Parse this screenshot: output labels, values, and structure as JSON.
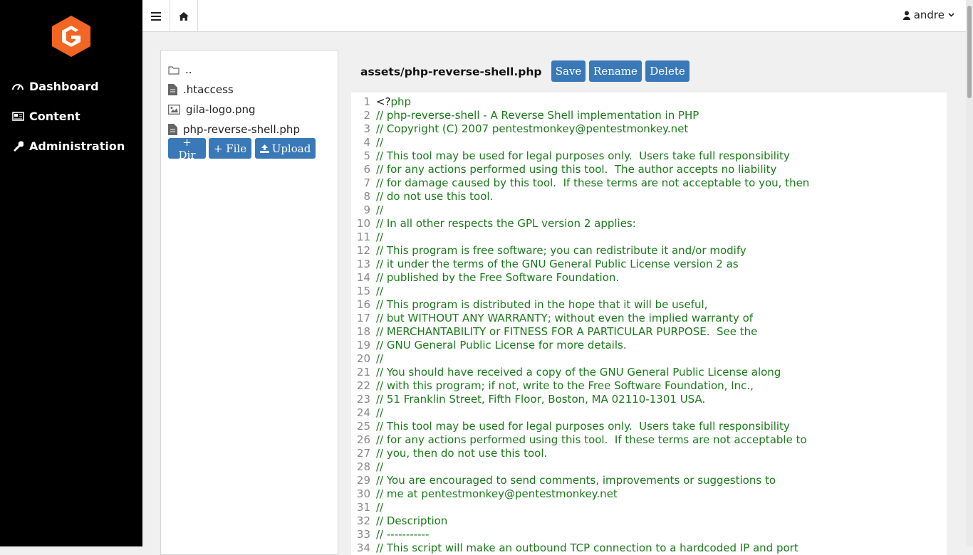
{
  "sidebar": {
    "items": [
      {
        "label": "Dashboard",
        "icon": "dashboard-icon"
      },
      {
        "label": "Content",
        "icon": "newspaper-icon"
      },
      {
        "label": "Administration",
        "icon": "wrench-icon"
      }
    ],
    "brand_color": "#f26522"
  },
  "topbar": {
    "menu_icon": "hamburger-icon",
    "home_icon": "home-icon",
    "user_label": "andre"
  },
  "files": {
    "items": [
      {
        "name": "..",
        "icon": "folder-icon"
      },
      {
        "name": ".htaccess",
        "icon": "file-icon"
      },
      {
        "name": "gila-logo.png",
        "icon": "image-icon"
      },
      {
        "name": "php-reverse-shell.php",
        "icon": "file-icon"
      }
    ],
    "dir_button": "+ Dir",
    "file_button": "+ File",
    "upload_button": "Upload"
  },
  "editor": {
    "path": "assets/php-reverse-shell.php",
    "save_button": "Save",
    "rename_button": "Rename",
    "delete_button": "Delete",
    "lines": [
      "<?php",
      "// php-reverse-shell - A Reverse Shell implementation in PHP",
      "// Copyright (C) 2007 pentestmonkey@pentestmonkey.net",
      "//",
      "// This tool may be used for legal purposes only.  Users take full responsibility",
      "// for any actions performed using this tool.  The author accepts no liability",
      "// for damage caused by this tool.  If these terms are not acceptable to you, then",
      "// do not use this tool.",
      "//",
      "// In all other respects the GPL version 2 applies:",
      "//",
      "// This program is free software; you can redistribute it and/or modify",
      "// it under the terms of the GNU General Public License version 2 as",
      "// published by the Free Software Foundation.",
      "//",
      "// This program is distributed in the hope that it will be useful,",
      "// but WITHOUT ANY WARRANTY; without even the implied warranty of",
      "// MERCHANTABILITY or FITNESS FOR A PARTICULAR PURPOSE.  See the",
      "// GNU General Public License for more details.",
      "//",
      "// You should have received a copy of the GNU General Public License along",
      "// with this program; if not, write to the Free Software Foundation, Inc.,",
      "// 51 Franklin Street, Fifth Floor, Boston, MA 02110-1301 USA.",
      "//",
      "// This tool may be used for legal purposes only.  Users take full responsibility",
      "// for any actions performed using this tool.  If these terms are not acceptable to",
      "// you, then do not use this tool.",
      "//",
      "// You are encouraged to send comments, improvements or suggestions to",
      "// me at pentestmonkey@pentestmonkey.net",
      "//",
      "// Description",
      "// -----------",
      "// This script will make an outbound TCP connection to a hardcoded IP and port"
    ]
  }
}
